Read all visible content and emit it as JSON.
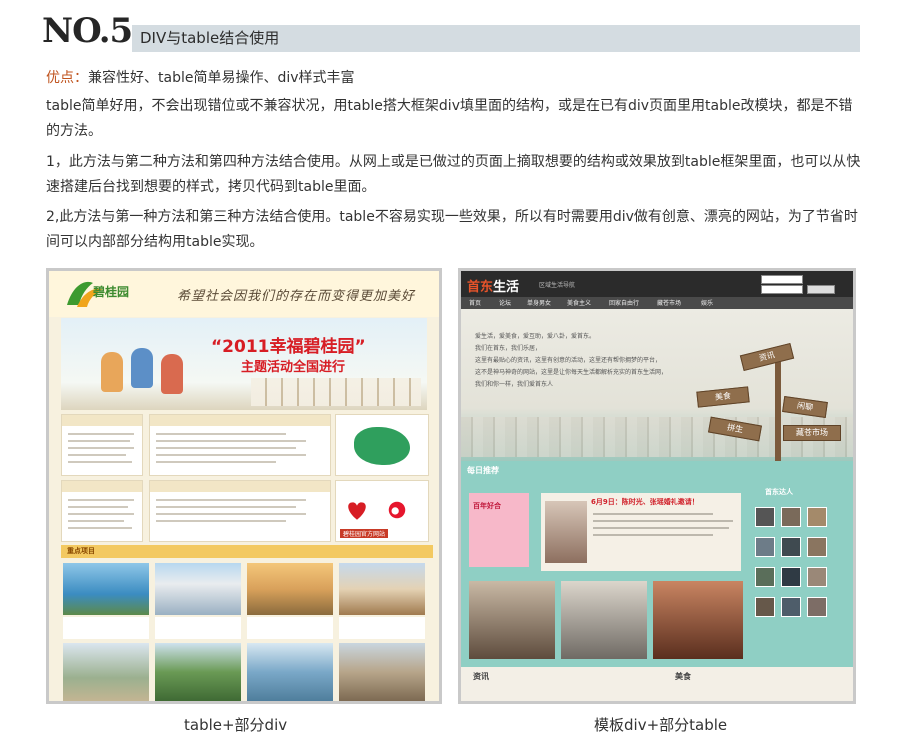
{
  "header": {
    "number": "NO.5",
    "title": "DIV与table结合使用"
  },
  "advantages": {
    "label": "优点：",
    "text": "兼容性好、table简单易操作、div样式丰富"
  },
  "paragraphs": [
    "table简单好用，不会出现错位或不兼容状况，用table搭大框架div填里面的结构，或是在已有div页面里用table改模块，都是不错的方法。",
    "1，此方法与第二种方法和第四种方法结合使用。从网上或是已做过的页面上摘取想要的结构或效果放到table框架里面，也可以从快速搭建后台找到想要的样式，拷贝代码到table里面。",
    "2,此方法与第一种方法和第三种方法结合使用。table不容易实现一些效果，所以有时需要用div做有创意、漂亮的网站，为了节省时间可以内部部分结构用table实现。"
  ],
  "left_example": {
    "caption": "table+部分div",
    "logo": "碧桂园",
    "slogan": "希望社会因我们的存在而变得更加美好",
    "banner_title": "“2011幸福碧桂园”",
    "banner_subtitle": "主题活动全国进行",
    "section_title": "重点项目",
    "site_label": "碧桂园官方网站",
    "colors": {
      "accent": "#d71d24",
      "section": "#f3c961"
    }
  },
  "right_example": {
    "caption": "模板div+部分table",
    "logo_a": "首东",
    "logo_b": "生活",
    "tagline": "区域生活导航",
    "nav": [
      "首页",
      "论坛",
      "单身男女",
      "美食主义",
      "回家自由行",
      "藏苍市场",
      "娱乐"
    ],
    "hero_lines": [
      "爱生活，爱美食，爱互助，爱八卦，爱首东。",
      "我们在首东，我们乐居，",
      "这里有最贴心的资讯，这里有创意的活动，这里还有帮你拥梦的平台，",
      "这不是神马神奇的网站，这里是让你每天生活都解析充实的首东生活网，",
      "我们和你一样，我们爱首东人"
    ],
    "signs": [
      "资讯",
      "美食",
      "闲聊",
      "拼生",
      "藏苍市场"
    ],
    "daily_title": "每日推荐",
    "article_title": "6月9日：陈时光、张瑶婚礼邀请！",
    "wedding_tag": "百年好合",
    "users_title": "首东达人",
    "bottom_left": "资讯",
    "bottom_right": "美食",
    "colors": {
      "accent": "#e8542a",
      "main": "#8fcfc4"
    }
  }
}
